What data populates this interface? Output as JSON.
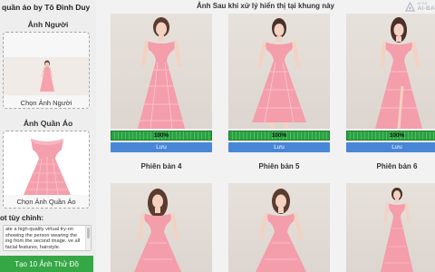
{
  "sidebar": {
    "app_title": "quần áo by Tô Đình Duy",
    "person_section": {
      "label": "Ảnh Người",
      "button_label": "Chọn Ảnh Người"
    },
    "clothes_section": {
      "label": "Ảnh Quần Áo",
      "button_label": "Chọn Ảnh Quần Áo"
    },
    "prompt": {
      "label": "ot tùy chỉnh:",
      "text": "ate a high-quality virtual try-on showing the person wearing the ing from the second image. ve all facial features, hairstyle."
    },
    "generate_label": "Tạo 10 Ảnh Thử Đồ"
  },
  "main": {
    "title": "Ảnh Sau khi xử lý hiển thị tại khung này",
    "brand": {
      "name": "AI-BA",
      "sub": "ai-ba"
    },
    "results_row1": [
      {
        "progress": 100,
        "progress_label": "100%",
        "save_label": "Lưu"
      },
      {
        "progress": 100,
        "progress_label": "100%",
        "save_label": "Lưu"
      },
      {
        "progress": 100,
        "progress_label": "100%",
        "save_label": "Lưu"
      }
    ],
    "results_row2": [
      {
        "label": "Phiên bản 4"
      },
      {
        "label": "Phiên bản 5"
      },
      {
        "label": "Phiên bản 6"
      }
    ]
  },
  "colors": {
    "accent_green": "#35a845",
    "progress_green": "#2ea043",
    "save_blue": "#4a86d8",
    "dress_pink": "#f29aa7"
  }
}
